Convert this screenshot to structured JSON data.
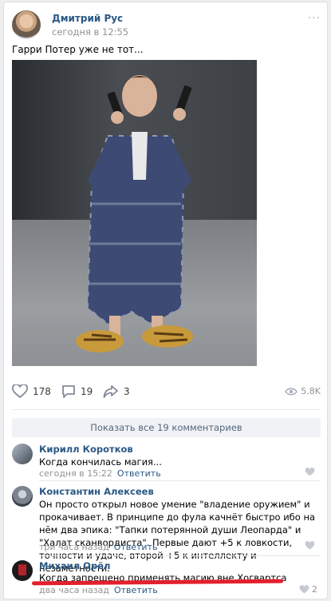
{
  "post": {
    "author": "Дмитрий Рус",
    "time": "сегодня в 12:55",
    "more": "···",
    "text": "Гарри Потер уже не тот..."
  },
  "actions": {
    "likes": "178",
    "comments": "19",
    "shares": "3",
    "views": "5.8K"
  },
  "show_all_comments": "Показать все 19 комментариев",
  "comments": [
    {
      "author": "Кирилл Коротков",
      "text": "Когда кончилась магия...",
      "time": "сегодня в 15:22",
      "reply": "Ответить",
      "likes": ""
    },
    {
      "author": "Константин Алексеев",
      "text": "Он просто открыл новое умение \"владение оружием\" и прокачивает. В принципе до фула качнёт быстро ибо на нём два эпика: \"Тапки потерянной души Леопарда\" и \"Халат сканвордиста\". Первые дают +5 к ловкости, точности и удаче, второй +5 к интеллекту и незаметности.",
      "time": "три часа назад",
      "reply": "Ответить",
      "likes": ""
    },
    {
      "author": "Михаил Орёл",
      "text": "Когда запрещено применять магию вне Хогвартса",
      "time": "два часа назад",
      "reply": "Ответить",
      "likes": "2"
    }
  ],
  "colors": {
    "link": "#2a5885",
    "meta": "#939393",
    "highlight": "#e3202d"
  }
}
